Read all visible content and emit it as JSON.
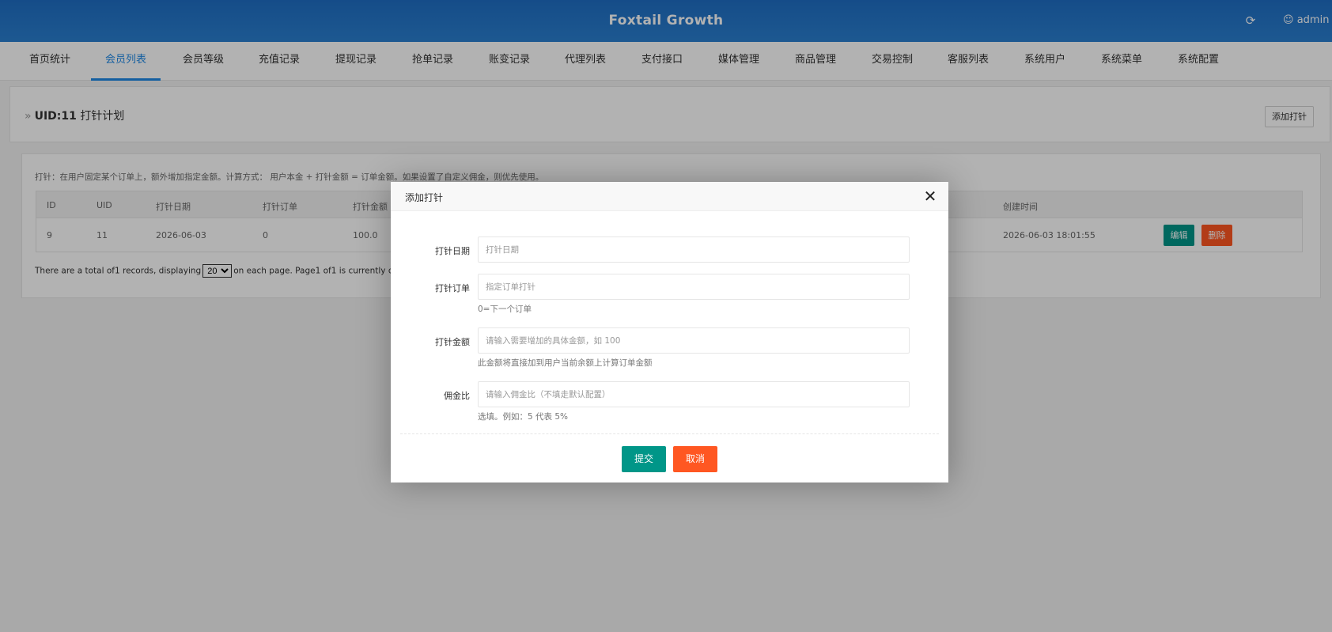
{
  "header": {
    "title": "Foxtail Growth",
    "user": "admin",
    "refresh_icon": "refresh-icon",
    "user_icon": "user-icon"
  },
  "nav": {
    "items": [
      "首页统计",
      "会员列表",
      "会员等级",
      "充值记录",
      "提现记录",
      "抢单记录",
      "账变记录",
      "代理列表",
      "支付接口",
      "媒体管理",
      "商品管理",
      "交易控制",
      "客服列表",
      "系统用户",
      "系统菜单",
      "系统配置"
    ],
    "active": "会员列表"
  },
  "page": {
    "uid_label": "UID:11",
    "title": "打针计划",
    "add_button": "添加打针"
  },
  "hint": "打针：在用户固定某个订单上，额外增加指定金额。计算方式： 用户本金 + 打针金额 = 订单金额。如果设置了自定义佣金，则优先使用。",
  "table": {
    "headers": [
      "ID",
      "UID",
      "打针日期",
      "打针订单",
      "打针金额",
      "创建时间"
    ],
    "rows": [
      {
        "id": "9",
        "uid": "11",
        "date": "2026-06-03",
        "order": "0",
        "amount": "100.0",
        "created": "2026-06-03 18:01:55",
        "edit": "编辑",
        "delete": "删除"
      }
    ]
  },
  "pager": {
    "before": "There are a total of1 records, displaying",
    "page_size": "20",
    "after": "on each page. Page1 of1 is currently displayed."
  },
  "modal": {
    "title": "添加打针",
    "fields": [
      {
        "label": "打针日期",
        "placeholder": "打针日期",
        "help": ""
      },
      {
        "label": "打针订单",
        "placeholder": "指定订单打针",
        "help": "0=下一个订单"
      },
      {
        "label": "打针金额",
        "placeholder": "请输入需要增加的具体金额，如 100",
        "help": "此金额将直接加到用户当前余额上计算订单金额"
      },
      {
        "label": "佣金比",
        "placeholder": "请输入佣金比（不填走默认配置）",
        "help": "选填。例如：5 代表 5%"
      }
    ],
    "submit": "提交",
    "cancel": "取消"
  },
  "colors": {
    "header": "#1f6ec4",
    "accent_blue": "#1e88e5",
    "primary_green": "#009688",
    "danger_orange": "#ff5722"
  }
}
